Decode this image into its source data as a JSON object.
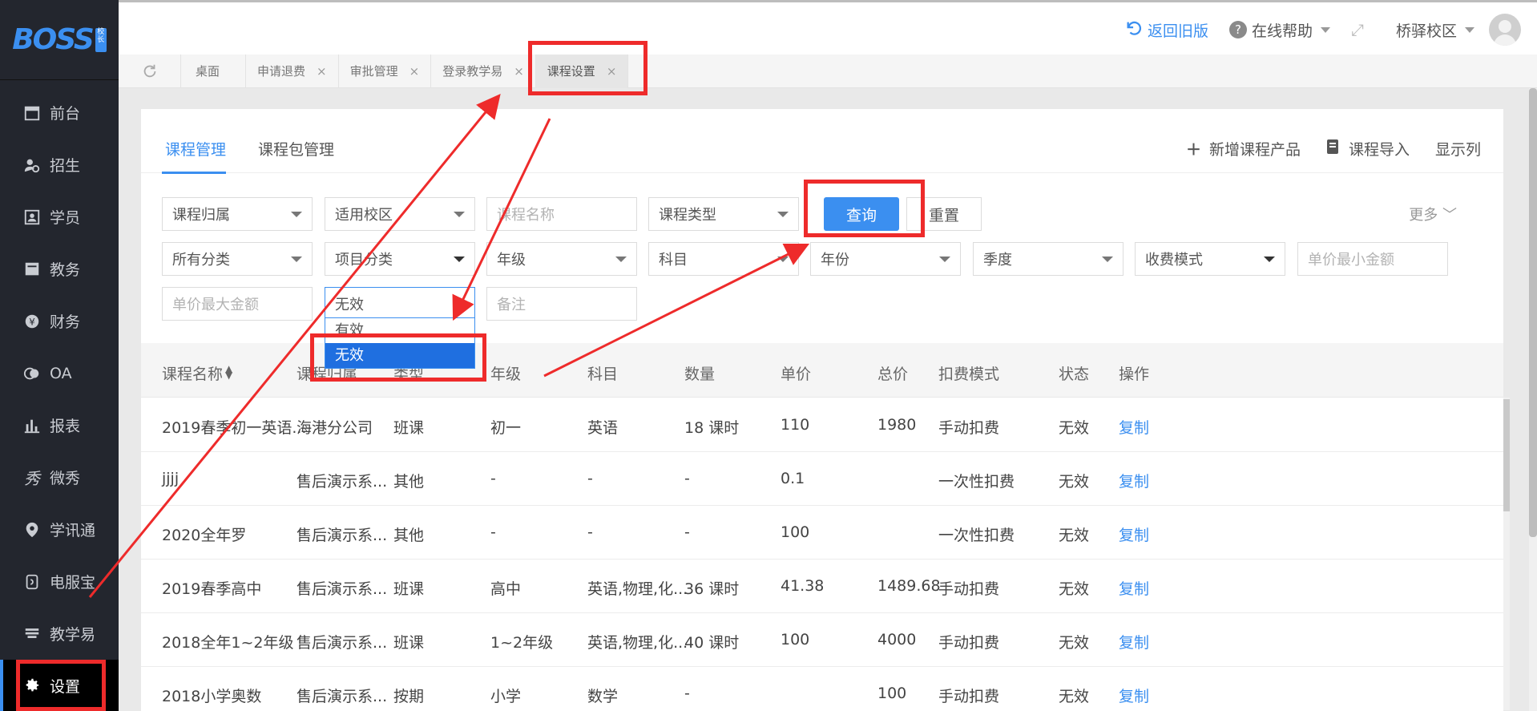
{
  "app": {
    "logo_text": "BOSS",
    "logo_badge": "校长"
  },
  "sidebar": {
    "items": [
      {
        "label": "前台",
        "icon": "calendar-icon"
      },
      {
        "label": "招生",
        "icon": "user-add-icon"
      },
      {
        "label": "学员",
        "icon": "contact-card-icon"
      },
      {
        "label": "教务",
        "icon": "book-icon"
      },
      {
        "label": "财务",
        "icon": "yen-icon"
      },
      {
        "label": "OA",
        "icon": "chat-icon"
      },
      {
        "label": "报表",
        "icon": "bar-chart-icon"
      },
      {
        "label": "微秀",
        "icon": "xiu-icon"
      },
      {
        "label": "学讯通",
        "icon": "location-icon"
      },
      {
        "label": "电服宝",
        "icon": "phone-icon"
      },
      {
        "label": "教学易",
        "icon": "teach-icon"
      }
    ],
    "active": {
      "label": "设置",
      "icon": "gear-icon"
    }
  },
  "header": {
    "back_label": "返回旧版",
    "help_label": "在线帮助",
    "campus_label": "桥驿校区"
  },
  "page_tabs": [
    {
      "label": "桌面",
      "closable": false
    },
    {
      "label": "申请退费",
      "closable": true
    },
    {
      "label": "审批管理",
      "closable": true
    },
    {
      "label": "登录教学易",
      "closable": true
    },
    {
      "label": "课程设置",
      "closable": true,
      "active": true
    }
  ],
  "subtabs": {
    "course_mgmt": "课程管理",
    "package_mgmt": "课程包管理"
  },
  "actions": {
    "add": "新增课程产品",
    "import": "课程导入",
    "columns": "显示列"
  },
  "filters": {
    "course_owner": "课程归属",
    "campus": "适用校区",
    "course_name_ph": "课程名称",
    "course_type": "课程类型",
    "query_btn": "查询",
    "reset_btn": "重置",
    "more": "更多",
    "all_category": "所有分类",
    "project_category": "项目分类",
    "grade": "年级",
    "subject": "科目",
    "year": "年份",
    "season": "季度",
    "charge_mode": "收费模式",
    "unit_min_ph": "单价最小金额",
    "unit_max_ph": "单价最大金额",
    "status_value": "无效",
    "remark_ph": "备注",
    "status_options": [
      "有效",
      "无效"
    ],
    "status_selected": "无效"
  },
  "table": {
    "headers": [
      "课程名称",
      "课程归属",
      "类型",
      "年级",
      "科目",
      "数量",
      "单价",
      "总价",
      "扣费模式",
      "状态",
      "操作"
    ],
    "rows": [
      [
        "2019春季初一英语...",
        "海港分公司",
        "班课",
        "初一",
        "英语",
        "18 课时",
        "110",
        "1980",
        "手动扣费",
        "无效",
        "复制"
      ],
      [
        "jjjj",
        "售后演示系...",
        "其他",
        "-",
        "-",
        "-",
        "0.1",
        "",
        "一次性扣费",
        "无效",
        "复制"
      ],
      [
        "2020全年罗",
        "售后演示系...",
        "其他",
        "-",
        "-",
        "-",
        "100",
        "",
        "一次性扣费",
        "无效",
        "复制"
      ],
      [
        "2019春季高中",
        "售后演示系...",
        "班课",
        "高中",
        "英语,物理,化...",
        "36 课时",
        "41.38",
        "1489.68",
        "手动扣费",
        "无效",
        "复制"
      ],
      [
        "2018全年1~2年级",
        "售后演示系...",
        "班课",
        "1~2年级",
        "英语,物理,化...",
        "40 课时",
        "100",
        "4000",
        "手动扣费",
        "无效",
        "复制"
      ],
      [
        "2018小学奥数",
        "售后演示系...",
        "按期",
        "小学",
        "数学",
        "-",
        "",
        "100",
        "手动扣费",
        "无效",
        "复制"
      ]
    ]
  },
  "colors": {
    "accent": "#3b8ff0",
    "sidebar_bg": "#23262e",
    "annotation": "#ee2b2b"
  }
}
